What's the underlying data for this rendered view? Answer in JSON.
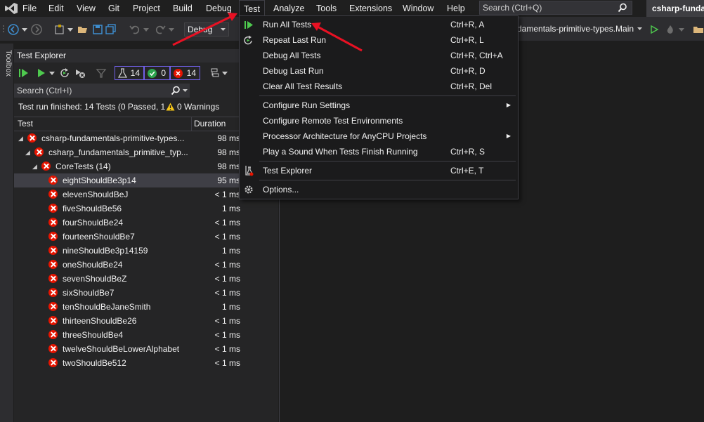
{
  "menubar": {
    "items": [
      "File",
      "Edit",
      "View",
      "Git",
      "Project",
      "Build",
      "Debug",
      "Test",
      "Analyze",
      "Tools",
      "Extensions",
      "Window",
      "Help"
    ],
    "search_placeholder": "Search (Ctrl+Q)",
    "solution_title": "csharp-fundam"
  },
  "toolbar": {
    "configuration": "Debug",
    "startup_item": "damentals-primitive-types.Main"
  },
  "toolbox": {
    "label": "Toolbox"
  },
  "test_explorer": {
    "title": "Test Explorer",
    "counters": {
      "total": "14",
      "passed": "0",
      "failed": "14"
    },
    "search_placeholder": "Search (Ctrl+I)",
    "status_text": "Test run finished: 14 Tests (0 Passed, 1",
    "warnings": "0 Warnings",
    "columns": {
      "test": "Test",
      "duration": "Duration"
    },
    "rows": [
      {
        "name": "csharp-fundamentals-primitive-types...",
        "duration": "98 ms"
      },
      {
        "name": "csharp_fundamentals_primitive_typ...",
        "duration": "98 ms"
      },
      {
        "name": "CoreTests  (14)",
        "duration": "98 ms"
      },
      {
        "name": "eightShouldBe3p14",
        "duration": "95 ms"
      },
      {
        "name": "elevenShouldBeJ",
        "duration": "< 1 ms"
      },
      {
        "name": "fiveShouldBe56",
        "duration": "1 ms"
      },
      {
        "name": "fourShouldBe24",
        "duration": "< 1 ms"
      },
      {
        "name": "fourteenShouldBe7",
        "duration": "< 1 ms"
      },
      {
        "name": "nineShouldBe3p14159",
        "duration": "1 ms"
      },
      {
        "name": "oneShouldBe24",
        "duration": "< 1 ms"
      },
      {
        "name": "sevenShouldBeZ",
        "duration": "< 1 ms"
      },
      {
        "name": "sixShouldBe7",
        "duration": "< 1 ms"
      },
      {
        "name": "tenShouldBeJaneSmith",
        "duration": "1 ms"
      },
      {
        "name": "thirteenShouldBe26",
        "duration": "< 1 ms"
      },
      {
        "name": "threeShouldBe4",
        "duration": "< 1 ms"
      },
      {
        "name": "twelveShouldBeLowerAlphabet",
        "duration": "< 1 ms"
      },
      {
        "name": "twoShouldBe512",
        "duration": "< 1 ms"
      }
    ]
  },
  "test_menu": {
    "items": [
      {
        "label": "Run All Tests",
        "shortcut": "Ctrl+R, A",
        "icon": "play-icon"
      },
      {
        "label": "Repeat Last Run",
        "shortcut": "Ctrl+R, L",
        "icon": "repeat-icon"
      },
      {
        "label": "Debug All Tests",
        "shortcut": "Ctrl+R, Ctrl+A",
        "icon": ""
      },
      {
        "label": "Debug Last Run",
        "shortcut": "Ctrl+R, D",
        "icon": ""
      },
      {
        "label": "Clear All Test Results",
        "shortcut": "Ctrl+R, Del",
        "icon": ""
      },
      {
        "label": "Configure Run Settings",
        "shortcut": "",
        "icon": "",
        "submenu": true
      },
      {
        "label": "Configure Remote Test Environments",
        "shortcut": "",
        "icon": ""
      },
      {
        "label": "Processor Architecture for AnyCPU Projects",
        "shortcut": "",
        "icon": "",
        "submenu": true
      },
      {
        "label": "Play a Sound When Tests Finish Running",
        "shortcut": "Ctrl+R, S",
        "icon": ""
      },
      {
        "label": "Test Explorer",
        "shortcut": "Ctrl+E, T",
        "icon": "test-explorer-icon"
      },
      {
        "label": "Options...",
        "shortcut": "",
        "icon": "gear-icon"
      }
    ]
  },
  "colors": {
    "background": "#1e1e1e",
    "panel": "#252526",
    "fail": "#e51400",
    "pass": "#2da44e",
    "accent_border": "#7160e8",
    "annotation_arrow": "#e81123"
  }
}
